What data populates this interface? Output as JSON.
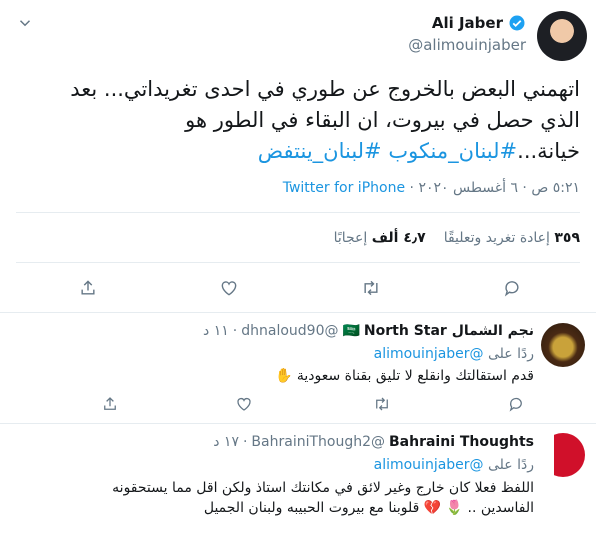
{
  "main_tweet": {
    "author_name": "Ali Jaber",
    "author_handle": "@alimouinjaber",
    "text_lines": [
      "اتهمني البعض بالخروج عن طوري في احدى تغريداتي... بعد",
      "الذي حصل في بيروت، ان البقاء في الطور هو"
    ],
    "text_line3_prefix": "خيانة...",
    "hashtags": [
      "#لبنان_منكوب",
      "#لبنان_ينتفض"
    ],
    "timestamp": "٥:٢١ ص · ٦ أغسطس ٢٠٢٠ · ",
    "source": "Twitter for iPhone",
    "stats": {
      "retweets_count": "٣٥٩",
      "retweets_label": "إعادة تغريد وتعليقًا",
      "likes_count": "٤٫٧ ألف",
      "likes_label": "إعجابًا"
    }
  },
  "replies": [
    {
      "name": "نجم الشمال",
      "name_suffix": "North Star",
      "flag": "🇸🇦",
      "handle": "@dhnaloud90",
      "time": "١١ د",
      "reply_to_prefix": "ردًا على",
      "reply_to_handle": "@alimouinjaber",
      "text": "قدم استقالتك وانقلع لا تليق بقناة سعودية ✋"
    },
    {
      "name": "Bahraini Thoughts",
      "handle": "@BahrainiThough2",
      "time": "١٧ د",
      "reply_to_prefix": "ردًا على",
      "reply_to_handle": "@alimouinjaber",
      "text_lines": [
        "اللفظ فعلا كان خارج وغير لائق في مكانتك استاذ ولكن اقل مما يستحقونه",
        "الفاسدين .. 🌷 💔 قلوبنا مع بيروت الحبيبه ولبنان الجميل"
      ]
    }
  ],
  "colors": {
    "accent": "#1b95e0",
    "muted": "#657786",
    "divider": "#e6ecf0",
    "verified": "#1da1f2"
  }
}
